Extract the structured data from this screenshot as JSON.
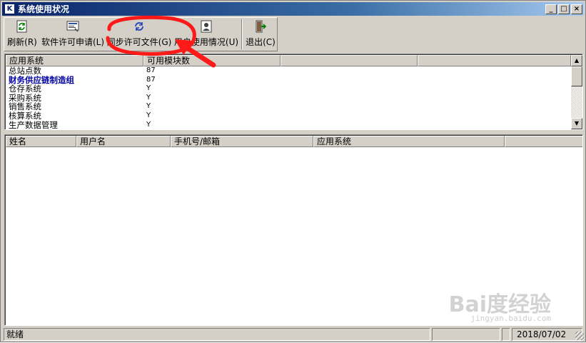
{
  "window": {
    "title": "系统使用状况",
    "app_icon_glyph": "K",
    "controls": {
      "minimize": "_",
      "maximize": "□",
      "close": "×"
    }
  },
  "toolbar": {
    "buttons": [
      {
        "label": "刷新(R)",
        "icon": "refresh-icon"
      },
      {
        "label": "软件许可申请(L)",
        "icon": "license-request-icon"
      },
      {
        "label": "同步许可文件(G)",
        "icon": "sync-license-icon"
      },
      {
        "label": "用户使用情况(U)",
        "icon": "user-usage-icon"
      },
      {
        "label": "退出(C)",
        "icon": "exit-icon"
      }
    ]
  },
  "modules_table": {
    "columns": [
      "应用系统",
      "可用模块数",
      "",
      ""
    ],
    "rows": [
      {
        "system": "总站点数",
        "count": "87",
        "bold": false
      },
      {
        "system": "财务供应链制造组",
        "count": "87",
        "bold": true
      },
      {
        "system": "仓存系统",
        "count": "Y",
        "bold": false
      },
      {
        "system": "采购系统",
        "count": "Y",
        "bold": false
      },
      {
        "system": "销售系统",
        "count": "Y",
        "bold": false
      },
      {
        "system": "核算系统",
        "count": "Y",
        "bold": false
      },
      {
        "system": "生产数据管理",
        "count": "Y",
        "bold": false
      }
    ]
  },
  "users_table": {
    "columns": [
      "姓名",
      "用户名",
      "手机号/邮箱",
      "应用系统",
      ""
    ],
    "rows": []
  },
  "statusbar": {
    "status": "就绪",
    "pane2": "",
    "pane3": "",
    "date": "2018/07/02"
  },
  "watermark": {
    "brand": "Bai度经验",
    "url": "jingyan.baidu.com"
  },
  "colors": {
    "title_gradient_start": "#0a246a",
    "annotation_red": "#ff1a1a",
    "bold_row_text": "#0000a0",
    "face": "#d4d0c8"
  }
}
